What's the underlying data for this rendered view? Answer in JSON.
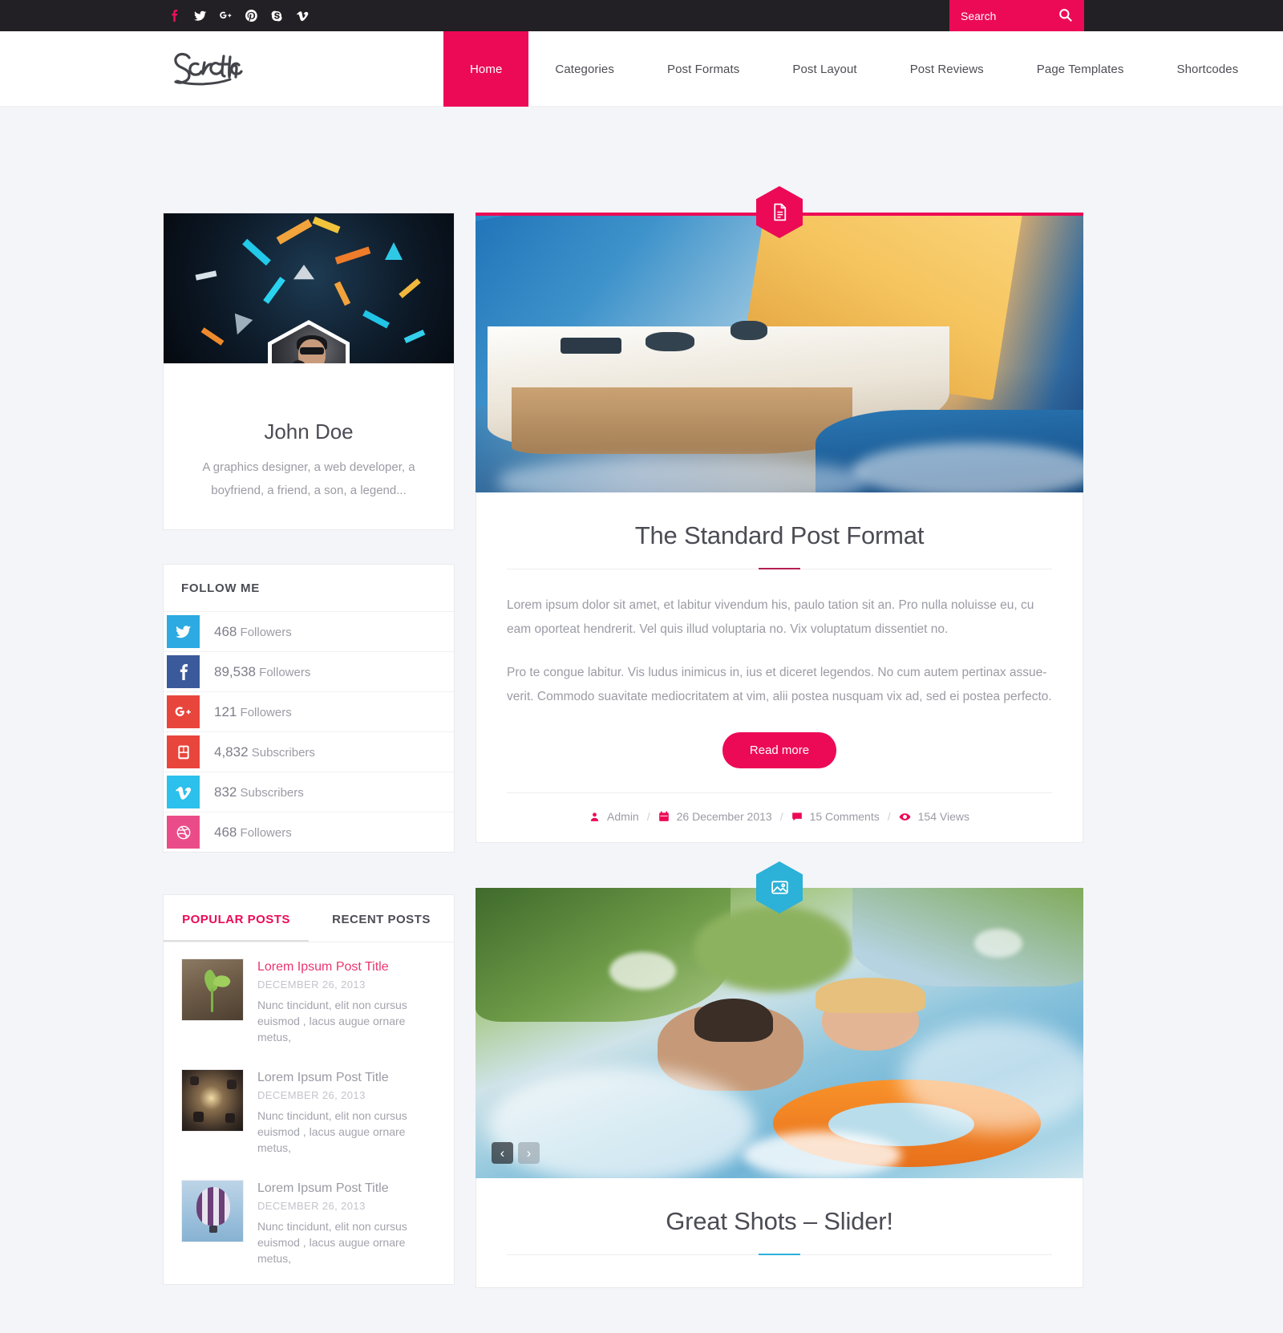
{
  "colors": {
    "primary": "#ec0a56",
    "secondary": "#2cb1d8",
    "dark": "#222024",
    "text": "#4c4c55",
    "muted": "#9b9ba5",
    "page_bg": "#f4f5f9"
  },
  "topbar": {
    "social": [
      {
        "name": "facebook-icon",
        "label": "Facebook",
        "active": true
      },
      {
        "name": "twitter-icon",
        "label": "Twitter",
        "active": false
      },
      {
        "name": "googleplus-icon",
        "label": "Google Plus",
        "active": false
      },
      {
        "name": "pinterest-icon",
        "label": "Pinterest",
        "active": false
      },
      {
        "name": "skype-icon",
        "label": "Skype",
        "active": false
      },
      {
        "name": "vimeo-icon",
        "label": "Vimeo",
        "active": false
      }
    ],
    "search": {
      "placeholder": "Search",
      "value": "",
      "button_icon": "search-icon"
    }
  },
  "header": {
    "logo_text": "Scratch",
    "nav": [
      {
        "label": "Home",
        "active": true
      },
      {
        "label": "Categories",
        "active": false
      },
      {
        "label": "Post Formats",
        "active": false
      },
      {
        "label": "Post Layout",
        "active": false
      },
      {
        "label": "Post Reviews",
        "active": false
      },
      {
        "label": "Page Templates",
        "active": false
      },
      {
        "label": "Shortcodes",
        "active": false
      }
    ]
  },
  "sidebar": {
    "author": {
      "name": "John Doe",
      "description": "A graphics designer, a web developer, a boyfriend, a friend, a son, a legend..."
    },
    "follow": {
      "title": "FOLLOW ME",
      "items": [
        {
          "icon": "twitter-icon",
          "count": "468",
          "label": "Followers",
          "color": "#2daae1"
        },
        {
          "icon": "facebook-icon",
          "count": "89,538",
          "label": "Followers",
          "color": "#3b5a9b"
        },
        {
          "icon": "googleplus-icon",
          "count": "121",
          "label": "Followers",
          "color": "#e8453c"
        },
        {
          "icon": "youtube-icon",
          "count": "4,832",
          "label": "Subscribers",
          "color": "#e8453c"
        },
        {
          "icon": "vimeo-icon",
          "count": "832",
          "label": "Subscribers",
          "color": "#2cc0ec"
        },
        {
          "icon": "dribbble-icon",
          "count": "468",
          "label": "Followers",
          "color": "#ea4c89"
        }
      ]
    },
    "posts_widget": {
      "tabs": [
        {
          "label": "POPULAR POSTS",
          "active": true
        },
        {
          "label": "RECENT POSTS",
          "active": false
        }
      ],
      "items": [
        {
          "title": "Lorem Ipsum Post Title",
          "date": "DECEMBER 26, 2013",
          "excerpt": "Nunc tincidunt, elit non cursus euismod , lacus augue ornare metus,",
          "thumb": "seedling-photo",
          "featured": true
        },
        {
          "title": "Lorem Ipsum Post Title",
          "date": "DECEMBER 26, 2013",
          "excerpt": "Nunc tincidunt, elit non cursus euismod , lacus augue ornare metus,",
          "thumb": "studio-lights-photo",
          "featured": false
        },
        {
          "title": "Lorem Ipsum Post Title",
          "date": "DECEMBER 26, 2013",
          "excerpt": "Nunc tincidunt, elit non cursus euismod , lacus augue ornare metus,",
          "thumb": "hot-air-balloon-photo",
          "featured": false
        }
      ]
    }
  },
  "posts": [
    {
      "badge_icon": "document-icon",
      "badge_color": "#ec0a56",
      "media": "sailboat-photo",
      "title": "The Standard Post Format",
      "paragraph1": "Lorem ipsum dolor sit amet, et labitur vivendum his, paulo tation sit an. Pro nulla noluisse eu, cu eam oporteat hendrerit. Vel quis illud voluptaria no. Vix voluptatum dissentiet no.",
      "paragraph2": "Pro te congue labitur. Vis ludus inimicus in, ius et diceret legendos. No cum autem pertinax assue-verit. Commodo suavitate mediocritatem at vim, alii postea nusquam vix ad, sed ei postea perfecto.",
      "read_more": "Read more",
      "meta": {
        "author": "Admin",
        "date": "26 December 2013",
        "comments": "15 Comments",
        "views": "154 Views",
        "separator": "/"
      }
    },
    {
      "badge_icon": "gallery-icon",
      "badge_color": "#2cb1d8",
      "media": "pool-splash-photo",
      "title": "Great Shots – Slider!",
      "slider": {
        "prev": "‹",
        "next": "›"
      }
    }
  ]
}
